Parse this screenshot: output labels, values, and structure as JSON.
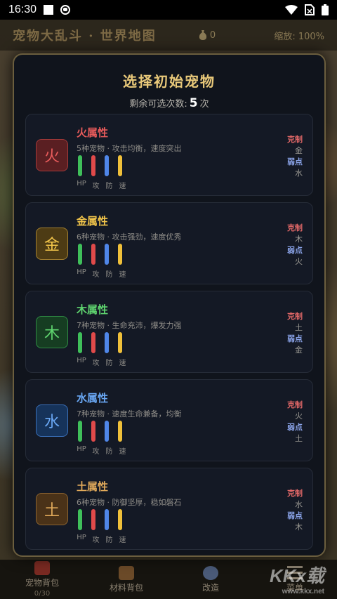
{
  "status": {
    "time": "16:30"
  },
  "topbar": {
    "title": "宠物大乱斗 · 世界地图",
    "coins": "0",
    "zoom": "缩放: 100%"
  },
  "modal": {
    "title": "选择初始宠物",
    "remaining_label": "剩余可选次数:",
    "remaining_count": "5",
    "remaining_unit": "次"
  },
  "stat_labels": [
    "HP",
    "攻",
    "防",
    "速"
  ],
  "relation_labels": {
    "restrain": "克制",
    "weak": "弱点"
  },
  "elements": [
    {
      "char": "火",
      "name": "火属性",
      "desc": "5种宠物 · 攻击均衡，速度突出",
      "restrains": "金",
      "weak_to": "水",
      "color": "#e85b5b",
      "badge_bg": "#5a1f22",
      "badge_border": "#a33a3a"
    },
    {
      "char": "金",
      "name": "金属性",
      "desc": "6种宠物 · 攻击强劲，速度优秀",
      "restrains": "木",
      "weak_to": "火",
      "color": "#f2c54a",
      "badge_bg": "#4d3b14",
      "badge_border": "#a38030"
    },
    {
      "char": "木",
      "name": "木属性",
      "desc": "7种宠物 · 生命充沛，爆发力强",
      "restrains": "土",
      "weak_to": "金",
      "color": "#5fd46f",
      "badge_bg": "#163d22",
      "badge_border": "#2f8a44"
    },
    {
      "char": "水",
      "name": "水属性",
      "desc": "7种宠物 · 速度生命兼备，均衡",
      "restrains": "火",
      "weak_to": "土",
      "color": "#6aa8f5",
      "badge_bg": "#16335a",
      "badge_border": "#3a6fb8"
    },
    {
      "char": "土",
      "name": "土属性",
      "desc": "6种宠物 · 防御坚厚，稳如磐石",
      "restrains": "水",
      "weak_to": "木",
      "color": "#e0a95a",
      "badge_bg": "#4a3218",
      "badge_border": "#8a6230"
    }
  ],
  "bottom_nav": [
    {
      "label": "宠物背包",
      "sub": "0/30"
    },
    {
      "label": "材料背包",
      "sub": ""
    },
    {
      "label": "改造",
      "sub": ""
    },
    {
      "label": "菜单",
      "sub": ""
    }
  ],
  "watermark": {
    "main": "KKx载",
    "sub": "www.kkx.net"
  }
}
